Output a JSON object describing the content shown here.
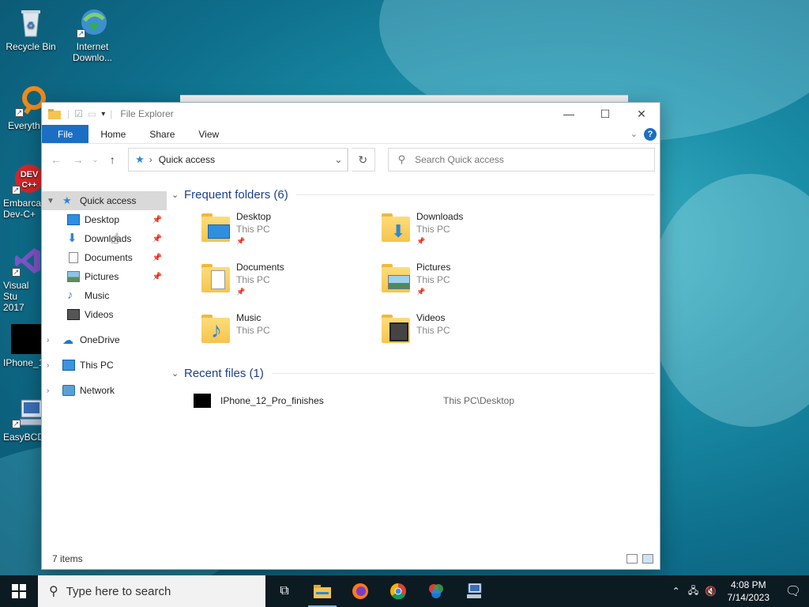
{
  "desktop": {
    "icons": [
      {
        "label": "Recycle Bin"
      },
      {
        "label": "Internet Downlo..."
      },
      {
        "label": "Everyth"
      },
      {
        "label": "Embarca Dev-C+"
      },
      {
        "label": "Visual Stu 2017"
      },
      {
        "label": "IPhone_1"
      },
      {
        "label": "EasyBCD"
      }
    ]
  },
  "window": {
    "title": "File Explorer",
    "ribbon": {
      "file": "File",
      "home": "Home",
      "share": "Share",
      "view": "View",
      "help": "?"
    },
    "address": {
      "path": "Quick access",
      "separator": "›"
    },
    "search": {
      "placeholder": "Search Quick access"
    },
    "sidebar": {
      "quick_access": "Quick access",
      "items": [
        {
          "label": "Desktop",
          "pinned": true
        },
        {
          "label": "Downloads",
          "pinned": true
        },
        {
          "label": "Documents",
          "pinned": true
        },
        {
          "label": "Pictures",
          "pinned": true
        },
        {
          "label": "Music",
          "pinned": false
        },
        {
          "label": "Videos",
          "pinned": false
        }
      ],
      "onedrive": "OneDrive",
      "this_pc": "This PC",
      "network": "Network"
    },
    "frequent": {
      "heading": "Frequent folders (6)",
      "folders": [
        {
          "name": "Desktop",
          "location": "This PC",
          "pinned": true
        },
        {
          "name": "Downloads",
          "location": "This PC",
          "pinned": true
        },
        {
          "name": "Documents",
          "location": "This PC",
          "pinned": true
        },
        {
          "name": "Pictures",
          "location": "This PC",
          "pinned": true
        },
        {
          "name": "Music",
          "location": "This PC",
          "pinned": false
        },
        {
          "name": "Videos",
          "location": "This PC",
          "pinned": false
        }
      ]
    },
    "recent": {
      "heading": "Recent files (1)",
      "files": [
        {
          "name": "IPhone_12_Pro_finishes",
          "path": "This PC\\Desktop"
        }
      ]
    },
    "status": "7 items"
  },
  "taskbar": {
    "search_placeholder": "Type here to search",
    "time": "4:08 PM",
    "date": "7/14/2023"
  },
  "colors": {
    "accent": "#1a6fc4",
    "heading": "#1e3f8a",
    "taskbar": "#0c1a22"
  }
}
